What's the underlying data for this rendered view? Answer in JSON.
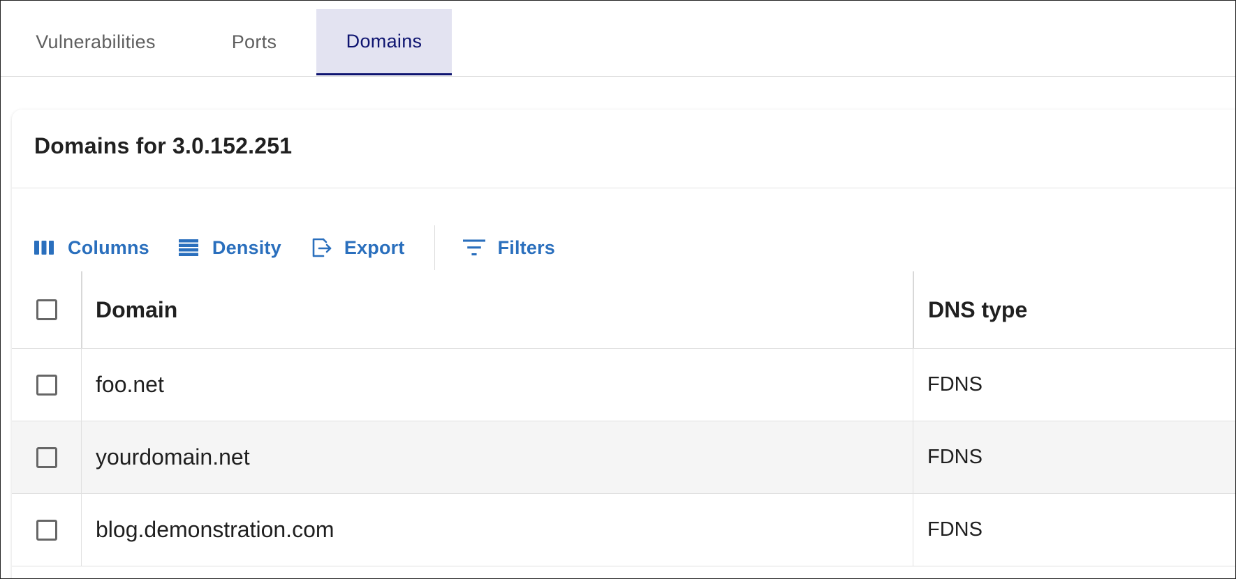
{
  "tabs": [
    {
      "label": "Vulnerabilities",
      "active": false
    },
    {
      "label": "Ports",
      "active": false
    },
    {
      "label": "Domains",
      "active": true
    }
  ],
  "panel": {
    "title": "Domains for 3.0.152.251"
  },
  "toolbar": {
    "columns_label": "Columns",
    "columns_icon": "view-columns-icon",
    "density_label": "Density",
    "density_icon": "density-icon",
    "export_label": "Export",
    "export_icon": "export-icon",
    "filters_label": "Filters",
    "filters_icon": "filter-icon"
  },
  "table": {
    "headers": [
      "Domain",
      "DNS type"
    ],
    "rows": [
      {
        "domain": "foo.net",
        "dns_type": "FDNS"
      },
      {
        "domain": "yourdomain.net",
        "dns_type": "FDNS"
      },
      {
        "domain": "blog.demonstration.com",
        "dns_type": "FDNS"
      }
    ]
  },
  "colors": {
    "accent": "#2a6fbd",
    "active_tab_text": "#0e1470",
    "active_tab_bg": "#e3e3f1",
    "row_alt_bg": "#f5f5f5"
  }
}
